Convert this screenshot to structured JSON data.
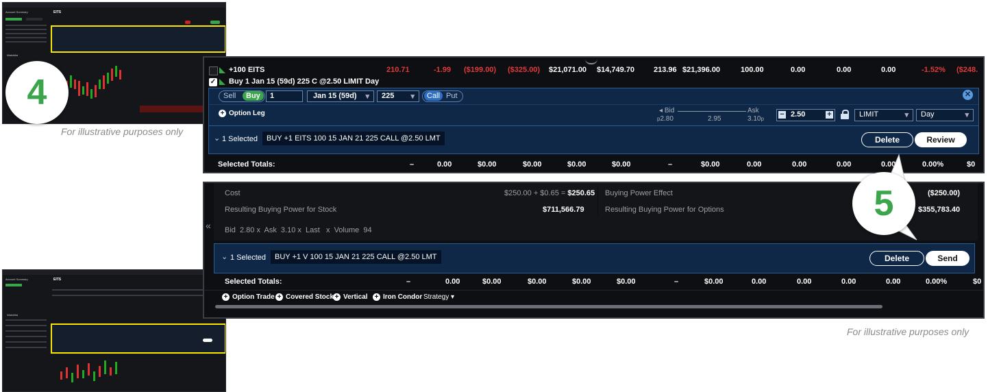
{
  "captions": {
    "caption_top": "For illustrative purposes only",
    "caption_bottom": "For illustrative purposes only"
  },
  "badges": {
    "step_four": "4",
    "step_five": "5"
  },
  "colors": {
    "accent_green": "#3aa54a",
    "highlight_yellow": "#f7e600",
    "order_blue": "#0f2847",
    "loss_red": "#e23a3a"
  },
  "thumbnail_top": {
    "title": "EITS",
    "panel_left": "Account Summary",
    "panel_watch": "Watchlist"
  },
  "position": {
    "symbol": "+100 EITS",
    "cells": [
      "210.71",
      "-1.99",
      "($199.00)",
      "($325.00)",
      "$21,071.00",
      "$14,749.70",
      "213.96",
      "$21,396.00",
      "100.00",
      "0.00",
      "0.00",
      "0.00",
      "-1.52%",
      "($248."
    ]
  },
  "order": {
    "title": "Buy 1 Jan 15 (59d) 225 C @2.50 LIMIT Day",
    "sell_label": "Sell",
    "buy_label": "Buy",
    "qty": "1",
    "expiry": "Jan 15 (59d)",
    "strike": "225",
    "call_label": "Call",
    "put_label": "Put",
    "option_leg_label": "Option Leg",
    "bid_label": "Bid",
    "ask_label": "Ask",
    "bid_low": "2.80",
    "mid": "2.95",
    "ask_high": "3.10",
    "price_prefix_bid": "p",
    "price_suffix_ask": "p",
    "limit_price": "2.50",
    "order_type": "LIMIT",
    "tif": "Day",
    "selected_text": "1 Selected",
    "summary": "BUY +1 EITS  100 15 JAN 21 225 CALL @2.50 LMT",
    "delete_label": "Delete",
    "review_label": "Review"
  },
  "totals_top": {
    "label": "Selected Totals:",
    "cells": [
      "–",
      "0.00",
      "$0.00",
      "$0.00",
      "$0.00",
      "$0.00",
      "–",
      "$0.00",
      "0.00",
      "0.00",
      "0.00",
      "0.00",
      "0.00%",
      "$0"
    ]
  },
  "confirm": {
    "cost_label": "Cost",
    "cost_value_pre": "$250.00 + $0.65 = ",
    "cost_value": "$250.65",
    "bp_effect_label": "Buying Power Effect",
    "bp_effect_value": "($250.00)",
    "bp_stock_label": "Resulting Buying Power for Stock",
    "bp_stock_value": "$711,566.79",
    "bp_options_label": "Resulting Buying Power for Options",
    "bp_options_value": "$355,783.40",
    "quote_line": "Bid  2.80 x  Ask  3.10 x  Last   x  Volume  94",
    "selected_text": "1 Selected",
    "summary": "BUY +1 V 100 15 JAN 21 225 CALL @2.50 LMT",
    "delete_label": "Delete",
    "send_label": "Send"
  },
  "totals_bottom": {
    "label": "Selected Totals:",
    "cells": [
      "–",
      "0.00",
      "$0.00",
      "$0.00",
      "$0.00",
      "$0.00",
      "–",
      "$0.00",
      "0.00",
      "0.00",
      "0.00",
      "0.00",
      "0.00%",
      "$0"
    ]
  },
  "strategies": {
    "option_trade": "Option Trade",
    "covered_stock": "Covered Stock",
    "vertical": "Vertical",
    "iron_condor": "Iron Condor",
    "strategy_menu": "Strategy"
  }
}
